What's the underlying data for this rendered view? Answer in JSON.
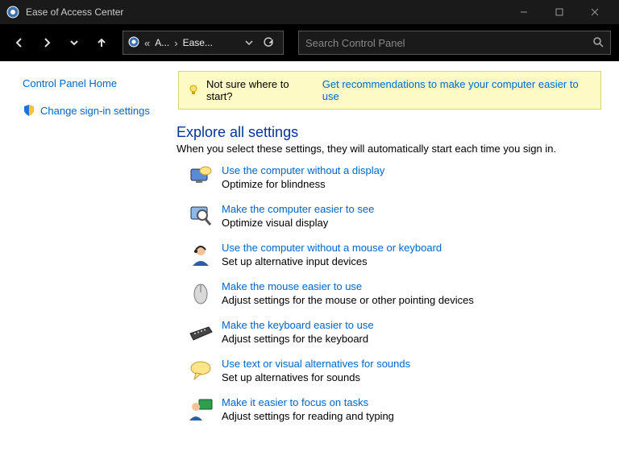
{
  "window": {
    "title": "Ease of Access Center"
  },
  "breadcrumb": {
    "seg1": "A...",
    "seg2": "Ease..."
  },
  "search": {
    "placeholder": "Search Control Panel"
  },
  "sidebar": {
    "home": "Control Panel Home",
    "signin": "Change sign-in settings"
  },
  "hint": {
    "lead": "Not sure where to start?",
    "link": "Get recommendations to make your computer easier to use"
  },
  "section": {
    "title": "Explore all settings",
    "sub": "When you select these settings, they will automatically start each time you sign in."
  },
  "settings": [
    {
      "link": "Use the computer without a display",
      "desc": "Optimize for blindness"
    },
    {
      "link": "Make the computer easier to see",
      "desc": "Optimize visual display"
    },
    {
      "link": "Use the computer without a mouse or keyboard",
      "desc": "Set up alternative input devices"
    },
    {
      "link": "Make the mouse easier to use",
      "desc": "Adjust settings for the mouse or other pointing devices"
    },
    {
      "link": "Make the keyboard easier to use",
      "desc": "Adjust settings for the keyboard"
    },
    {
      "link": "Use text or visual alternatives for sounds",
      "desc": "Set up alternatives for sounds"
    },
    {
      "link": "Make it easier to focus on tasks",
      "desc": "Adjust settings for reading and typing"
    }
  ]
}
